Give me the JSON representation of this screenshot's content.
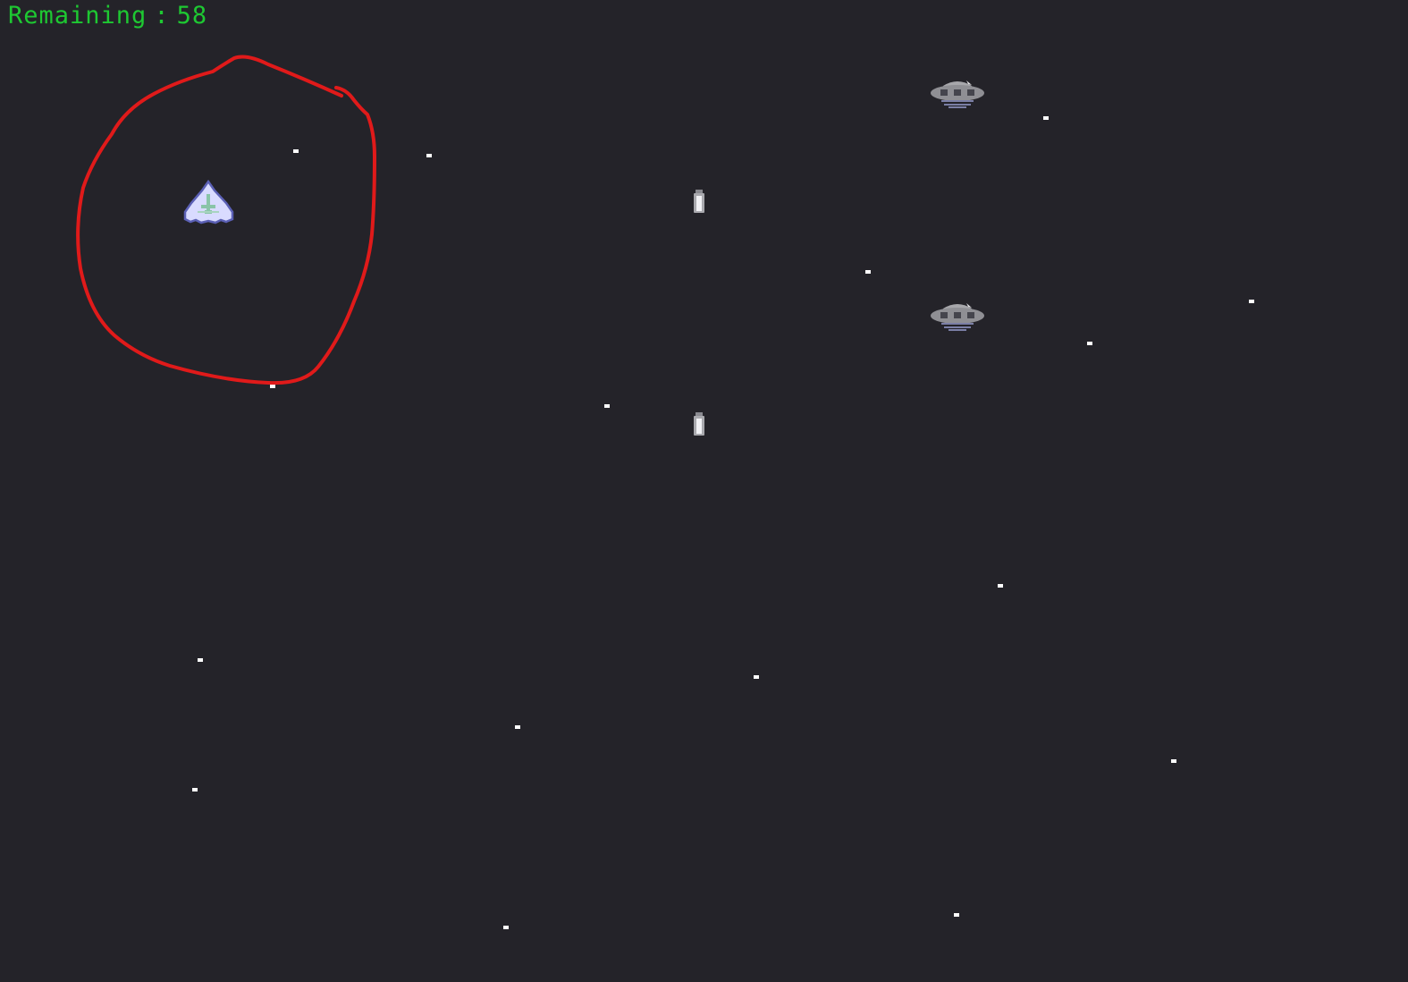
{
  "hud": {
    "remaining_label": "Remaining",
    "separator": ":",
    "remaining_value": "58"
  },
  "colors": {
    "background": "#242329",
    "hud_text": "#1ec832",
    "annotation": "#e01a1a",
    "star": "#ffffff",
    "player_fill": "#d6d8ff",
    "player_outline": "#5a5fb0",
    "player_detail": "#8fc9b0",
    "ufo_body": "#9a9a9e",
    "ufo_dark": "#4a4a52",
    "bullet": "#e8e8ec"
  },
  "sprites": {
    "player": "player-ship-icon",
    "enemy": "flying-saucer-icon",
    "projectile": "bullet-icon",
    "annotation": "red-freehand-circle"
  }
}
